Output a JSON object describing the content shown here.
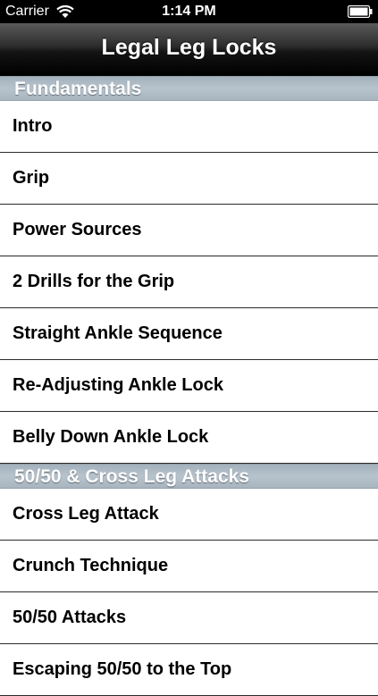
{
  "status_bar": {
    "carrier": "Carrier",
    "time": "1:14 PM"
  },
  "nav": {
    "title": "Legal Leg Locks"
  },
  "sections": [
    {
      "header": "Fundamentals",
      "items": [
        "Intro",
        "Grip",
        "Power Sources",
        "2 Drills for the Grip",
        "Straight Ankle Sequence",
        "Re-Adjusting Ankle Lock",
        "Belly Down Ankle Lock"
      ]
    },
    {
      "header": "50/50 & Cross Leg Attacks",
      "items": [
        "Cross Leg Attack",
        "Crunch Technique",
        "50/50 Attacks",
        "Escaping 50/50 to the Top"
      ]
    }
  ],
  "colors": {
    "section_header_bg": "#b0bcc6",
    "nav_bg": "#000000",
    "row_separator": "#2a2a2a"
  }
}
